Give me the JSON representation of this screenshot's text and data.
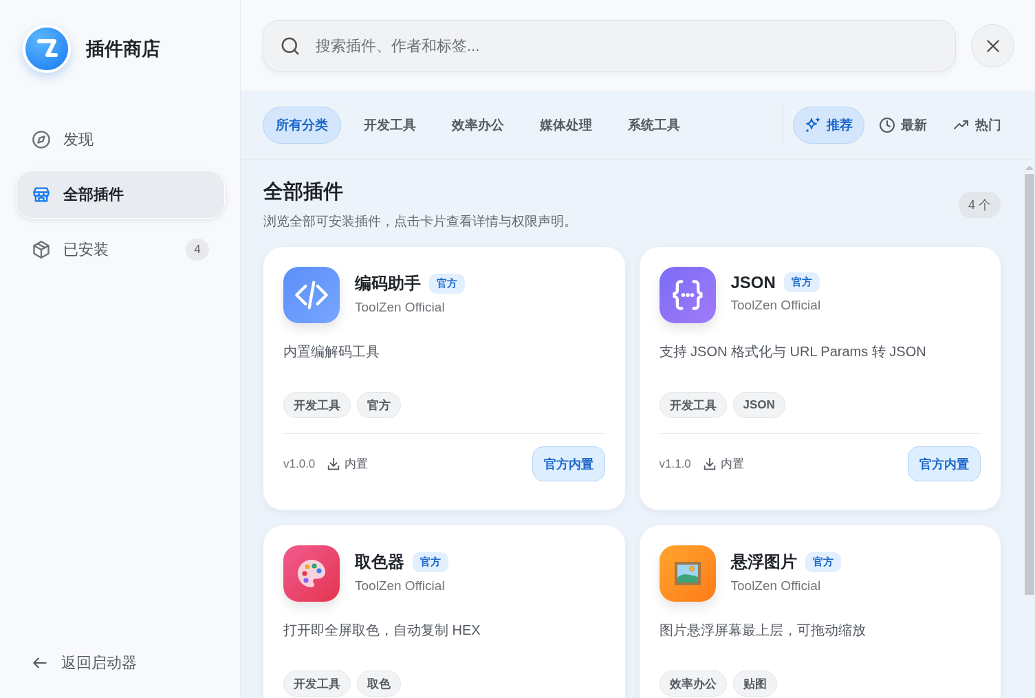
{
  "sidebar": {
    "title": "插件商店",
    "items": [
      {
        "label": "发现",
        "kind": "compass",
        "selected": false
      },
      {
        "label": "全部插件",
        "kind": "store",
        "selected": true
      },
      {
        "label": "已安装",
        "kind": "package",
        "selected": false,
        "badge": "4"
      }
    ],
    "back": "返回启动器"
  },
  "search": {
    "placeholder": "搜索插件、作者和标签..."
  },
  "categories": [
    {
      "label": "所有分类",
      "selected": true
    },
    {
      "label": "开发工具",
      "selected": false
    },
    {
      "label": "效率办公",
      "selected": false
    },
    {
      "label": "媒体处理",
      "selected": false
    },
    {
      "label": "系统工具",
      "selected": false
    }
  ],
  "sorts": [
    {
      "label": "推荐",
      "kind": "sparkle",
      "selected": true
    },
    {
      "label": "最新",
      "kind": "clock",
      "selected": false
    },
    {
      "label": "热门",
      "kind": "trend",
      "selected": false
    }
  ],
  "section": {
    "title": "全部插件",
    "subtitle": "浏览全部可安装插件，点击卡片查看详情与权限声明。",
    "count": "4 个"
  },
  "plugins": [
    {
      "kind": "code",
      "name": "编码助手",
      "badge": "官方",
      "author": "ToolZen Official",
      "description": "内置编解码工具",
      "tags": [
        "开发工具",
        "官方"
      ],
      "version": "v1.0.0",
      "install": "内置",
      "action": "官方内置"
    },
    {
      "kind": "json",
      "name": "JSON",
      "badge": "官方",
      "author": "ToolZen Official",
      "description": "支持 JSON 格式化与 URL Params 转 JSON",
      "tags": [
        "开发工具",
        "JSON"
      ],
      "version": "v1.1.0",
      "install": "内置",
      "action": "官方内置"
    },
    {
      "kind": "palette",
      "name": "取色器",
      "badge": "官方",
      "author": "ToolZen Official",
      "description": "打开即全屏取色，自动复制 HEX",
      "tags": [
        "开发工具",
        "取色"
      ]
    },
    {
      "kind": "frame",
      "name": "悬浮图片",
      "badge": "官方",
      "author": "ToolZen Official",
      "description": "图片悬浮屏幕最上层，可拖动缩放",
      "tags": [
        "效率办公",
        "贴图"
      ]
    }
  ]
}
